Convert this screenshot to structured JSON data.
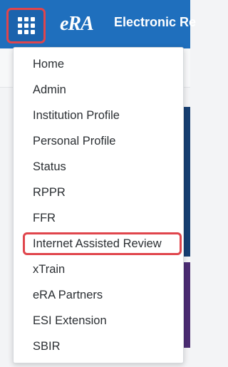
{
  "header": {
    "logo_text": "eRA",
    "title": "Electronic Re",
    "apps_button_icon": "grid-icon",
    "highlight_color": "#e0454c",
    "brand_color": "#1f6fbd"
  },
  "menu": {
    "items": [
      {
        "label": "Home"
      },
      {
        "label": "Admin"
      },
      {
        "label": "Institution Profile"
      },
      {
        "label": "Personal Profile"
      },
      {
        "label": "Status"
      },
      {
        "label": "RPPR"
      },
      {
        "label": "FFR"
      },
      {
        "label": "Internet Assisted Review"
      },
      {
        "label": "xTrain"
      },
      {
        "label": "eRA Partners"
      },
      {
        "label": "ESI Extension"
      },
      {
        "label": "SBIR"
      }
    ]
  }
}
